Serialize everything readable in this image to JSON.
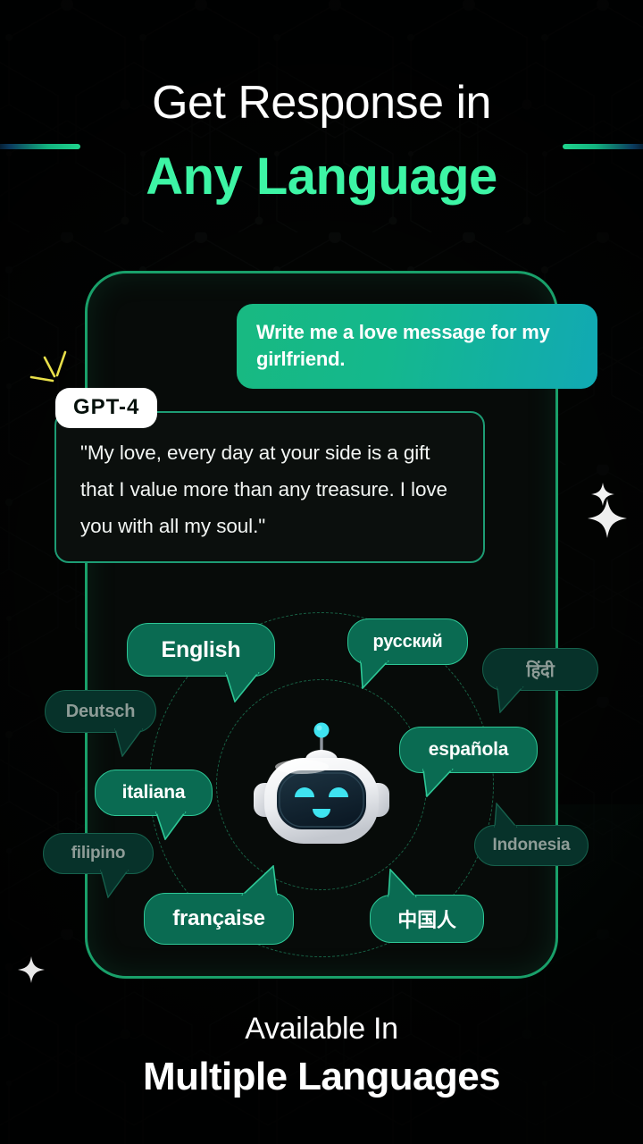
{
  "headline": {
    "line1": "Get Response in",
    "line2": "Any Language"
  },
  "colors": {
    "accent_green": "#3DF5A5",
    "bubble_fill": "#0a6b52",
    "bubble_border": "#2ec796",
    "frame_green": "#19a06a",
    "robot_cyan": "#3FE3F0",
    "badge_bg": "#ffffff",
    "background": "#030504"
  },
  "chat": {
    "user_message": "Write me a love message for my girlfriend.",
    "model_badge": "GPT-4",
    "bot_response": "\"My love, every day at your side is a gift that I value more than any treasure. I love you with all my soul.\""
  },
  "languages": [
    {
      "label": "English",
      "state": "active"
    },
    {
      "label": "русский",
      "state": "active"
    },
    {
      "label": "हिंदी",
      "state": "dim"
    },
    {
      "label": "Deutsch",
      "state": "dim"
    },
    {
      "label": "española",
      "state": "active"
    },
    {
      "label": "italiana",
      "state": "active"
    },
    {
      "label": "Indonesia",
      "state": "dim"
    },
    {
      "label": "filipino",
      "state": "dim"
    },
    {
      "label": "française",
      "state": "active"
    },
    {
      "label": "中国人",
      "state": "active"
    }
  ],
  "footer": {
    "line1": "Available In",
    "line2": "Multiple Languages"
  },
  "icons": {
    "robot": "robot-mascot-icon",
    "sparkle": "sparkle-star-icon",
    "burst": "burst-lines-icon"
  }
}
